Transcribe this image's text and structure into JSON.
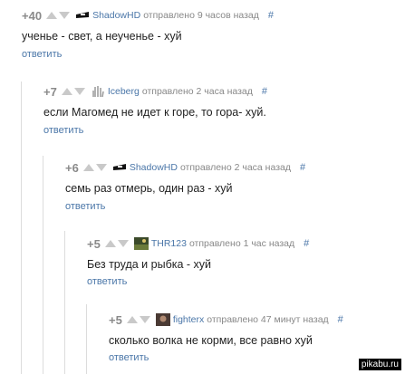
{
  "comments": [
    {
      "rating": "+40",
      "username": "ShadowHD",
      "meta": "отправлено 9 часов назад",
      "hash": "#",
      "text": "ученье - свет, а неученье - хуй",
      "reply": "ответить",
      "avatar": "ninja-avatar"
    },
    {
      "rating": "+7",
      "username": "Iceberg",
      "meta": "отправлено 2 часа назад",
      "hash": "#",
      "text": "если Магомед не идет к горе, то гора- хуй.",
      "reply": "ответить",
      "avatar": "hand-avatar"
    },
    {
      "rating": "+6",
      "username": "ShadowHD",
      "meta": "отправлено 2 часа назад",
      "hash": "#",
      "text": "семь раз отмерь, один раз - хуй",
      "reply": "ответить",
      "avatar": "ninja-avatar"
    },
    {
      "rating": "+5",
      "username": "THR123",
      "meta": "отправлено 1 час назад",
      "hash": "#",
      "text": "Без труда и рыбка - хуй",
      "reply": "ответить",
      "avatar": "landscape-avatar"
    },
    {
      "rating": "+5",
      "username": "fighterx",
      "meta": "отправлено 47 минут назад",
      "hash": "#",
      "text": "сколько волка не корми, все равно хуй",
      "reply": "ответить",
      "avatar": "photo-avatar"
    }
  ],
  "watermark": "pikabu.ru"
}
